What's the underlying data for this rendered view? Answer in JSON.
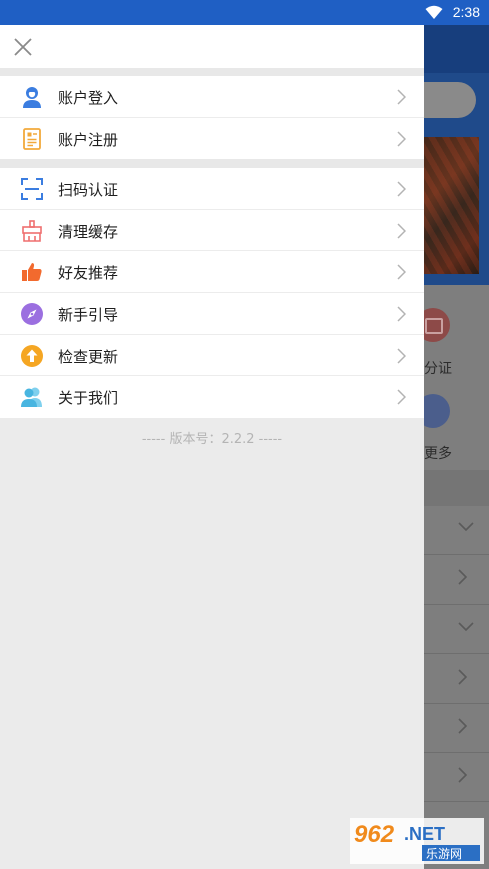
{
  "status_bar": {
    "time": "2:38"
  },
  "drawer": {
    "groups": [
      {
        "items": [
          {
            "label": "账户登入",
            "icon": "user-icon"
          },
          {
            "label": "账户注册",
            "icon": "register-form-icon"
          }
        ]
      },
      {
        "items": [
          {
            "label": "扫码认证",
            "icon": "scan-icon"
          },
          {
            "label": "清理缓存",
            "icon": "clean-cache-icon"
          },
          {
            "label": "好友推荐",
            "icon": "thumbs-up-icon"
          },
          {
            "label": "新手引导",
            "icon": "compass-icon"
          },
          {
            "label": "检查更新",
            "icon": "update-arrow-icon"
          },
          {
            "label": "关于我们",
            "icon": "people-icon"
          }
        ]
      }
    ],
    "version_text": "----- 版本号：2.2.2 -----"
  },
  "background_app": {
    "label_1": "分证",
    "label_2": "更多"
  },
  "watermark": {
    "text_top": "962.NET",
    "text_bottom": "乐游网"
  },
  "colors": {
    "status_bar": "#1f5fc4",
    "user_icon": "#3b7de0",
    "register_icon": "#f2a93b",
    "scan_icon": "#3b7de0",
    "clean_icon": "#ef6f6f",
    "thumb_icon": "#f26a2e",
    "compass_icon": "#9b6fe0",
    "update_icon": "#f5a623",
    "people_icon": "#48b5e0"
  }
}
